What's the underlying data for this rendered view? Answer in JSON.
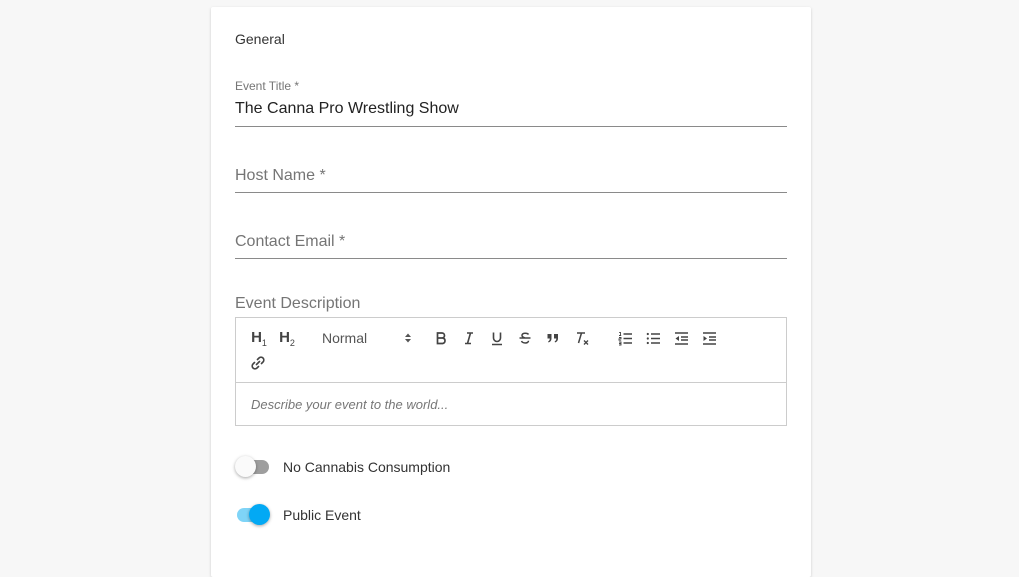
{
  "section_title": "General",
  "fields": {
    "event_title": {
      "label": "Event Title *",
      "value": "The Canna Pro Wrestling Show"
    },
    "host_name": {
      "label": "Host Name *",
      "value": ""
    },
    "contact_email": {
      "label": "Contact Email *",
      "value": ""
    }
  },
  "description": {
    "label": "Event Description",
    "placeholder": "Describe your event to the world...",
    "toolbar": {
      "h1": "H1",
      "h2": "H2",
      "size_select": "Normal",
      "icons": [
        "bold-icon",
        "italic-icon",
        "underline-icon",
        "strikethrough-icon",
        "blockquote-icon",
        "clear-format-icon",
        "ordered-list-icon",
        "bullet-list-icon",
        "outdent-icon",
        "indent-icon",
        "link-icon"
      ]
    }
  },
  "toggles": {
    "no_cannabis": {
      "label": "No Cannabis Consumption",
      "checked": false
    },
    "public_event": {
      "label": "Public Event",
      "checked": true
    }
  },
  "colors": {
    "accent": "#03a9f4",
    "accent_track": "#7fd4f7",
    "off_track": "#9e9e9e"
  }
}
